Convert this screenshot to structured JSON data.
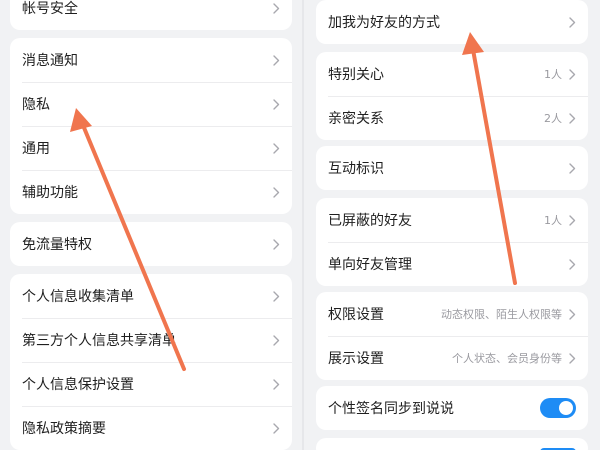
{
  "left_panel": {
    "groups": [
      {
        "items": [
          {
            "label": "帐号安全"
          }
        ]
      },
      {
        "items": [
          {
            "label": "消息通知"
          },
          {
            "label": "隐私"
          },
          {
            "label": "通用"
          },
          {
            "label": "辅助功能"
          }
        ]
      },
      {
        "items": [
          {
            "label": "免流量特权"
          }
        ]
      },
      {
        "items": [
          {
            "label": "个人信息收集清单"
          },
          {
            "label": "第三方个人信息共享清单"
          },
          {
            "label": "个人信息保护设置"
          },
          {
            "label": "隐私政策摘要"
          }
        ]
      }
    ]
  },
  "right_panel": {
    "groups": [
      {
        "items": [
          {
            "label": "加我为好友的方式"
          }
        ]
      },
      {
        "items": [
          {
            "label": "特别关心",
            "value": "1人"
          },
          {
            "label": "亲密关系",
            "value": "2人"
          }
        ]
      },
      {
        "items": [
          {
            "label": "互动标识"
          }
        ]
      },
      {
        "items": [
          {
            "label": "已屏蔽的好友",
            "value": "1人"
          },
          {
            "label": "单向好友管理"
          }
        ]
      },
      {
        "items": [
          {
            "label": "权限设置",
            "value": "动态权限、陌生人权限等"
          },
          {
            "label": "展示设置",
            "value": "个人状态、会员身份等"
          }
        ]
      },
      {
        "items": [
          {
            "label": "个性签名同步到说说",
            "toggle": true
          }
        ]
      }
    ]
  },
  "colors": {
    "background": "#f1f2f4",
    "card": "#ffffff",
    "toggle_on": "#1e8cf5",
    "annotation_arrow": "#f0754e"
  }
}
